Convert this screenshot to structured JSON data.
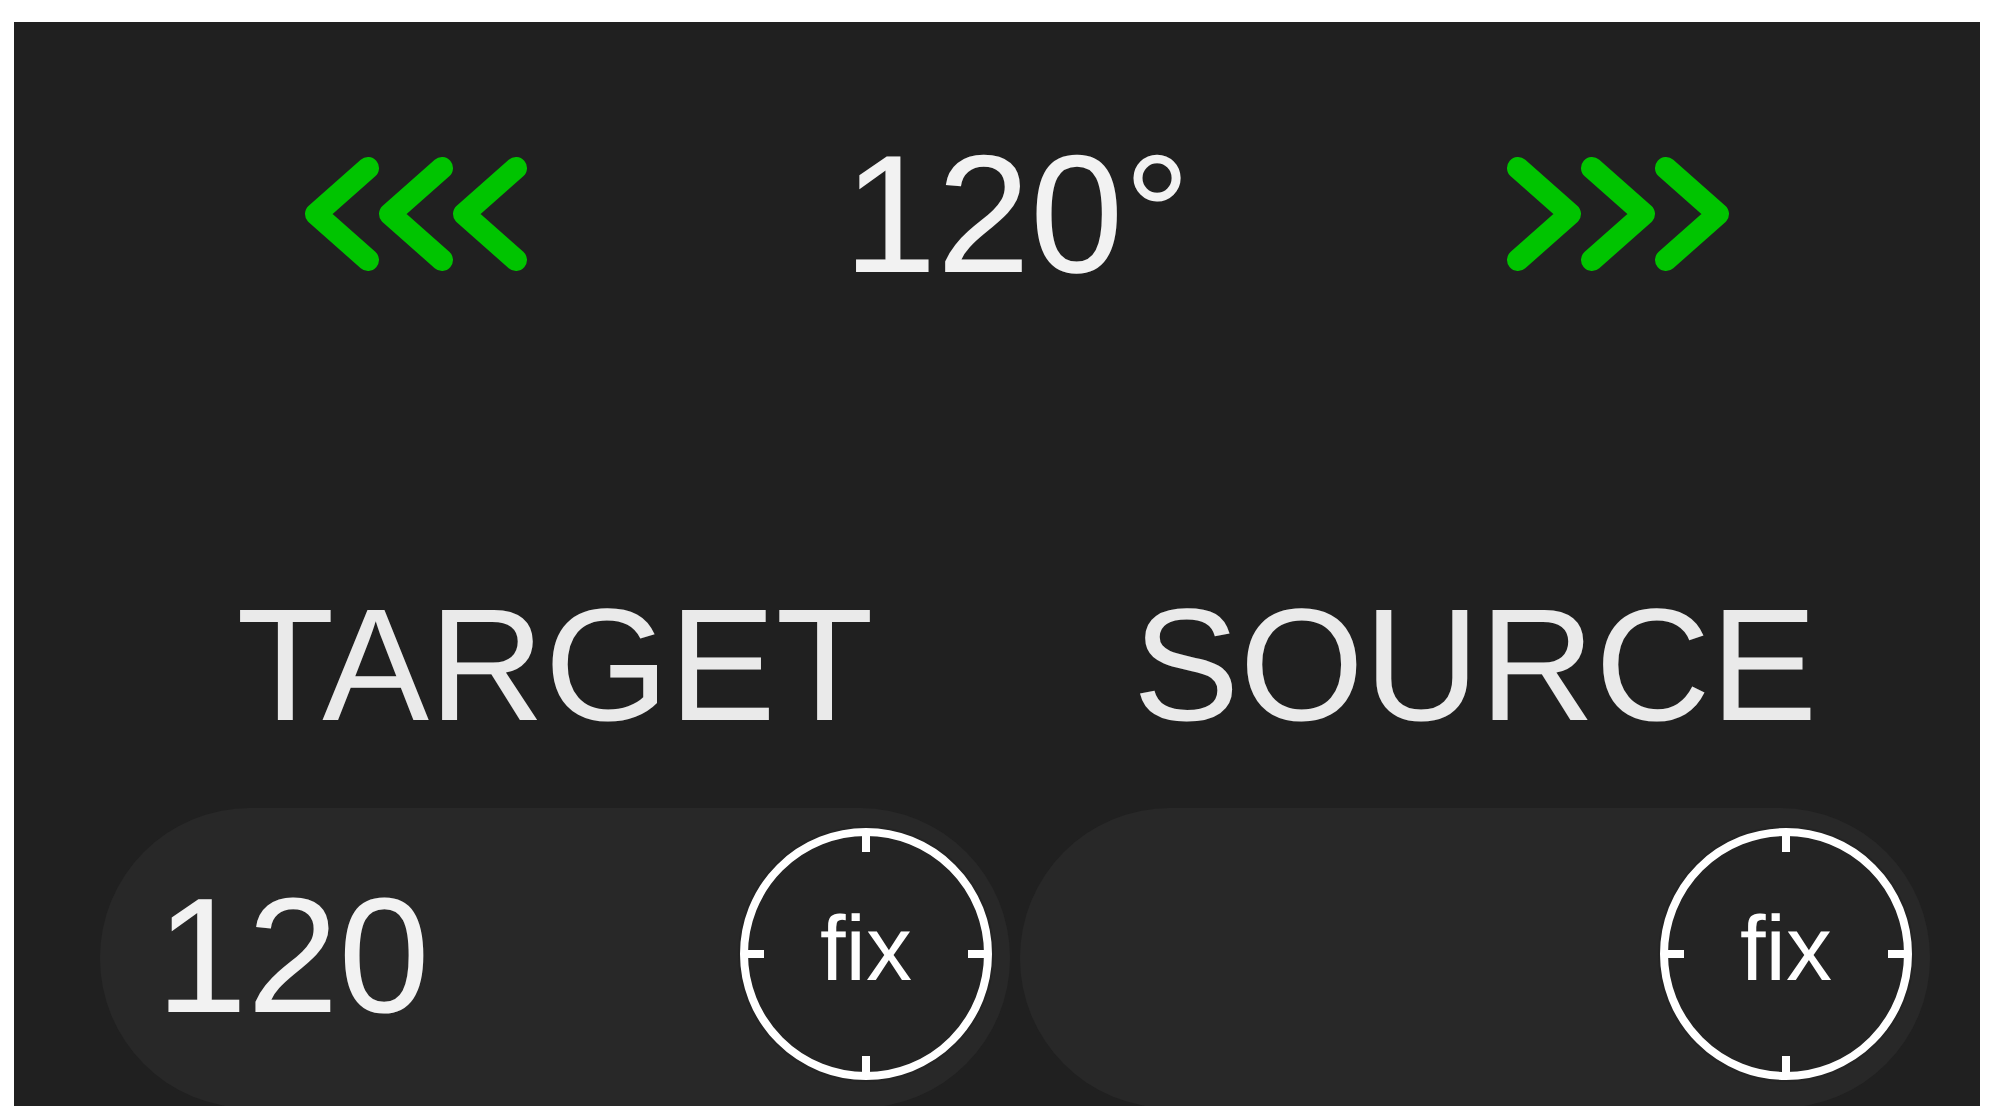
{
  "reading": "120°",
  "fields": [
    {
      "label": "TARGET",
      "value": "120",
      "button": "fix"
    },
    {
      "label": "SOURCE",
      "button": "fix"
    }
  ]
}
